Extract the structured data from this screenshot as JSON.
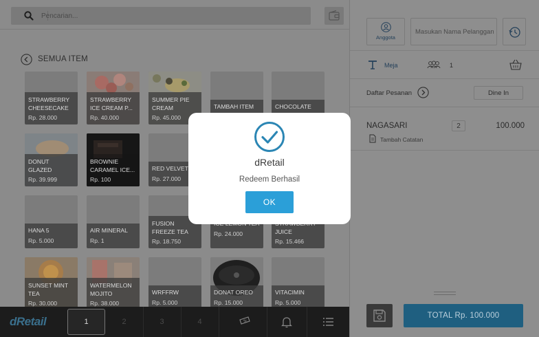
{
  "search": {
    "placeholder": "Pencarian..."
  },
  "category": {
    "title": "SEMUA ITEM"
  },
  "products": [
    {
      "name": "STRAWBERRY CHEESECAKE",
      "price": "Rp. 28.000"
    },
    {
      "name": "STRAWBERRY ICE CREAM P...",
      "price": "Rp. 40.000"
    },
    {
      "name": "SUMMER PIE CREAM",
      "price": "Rp. 45.000"
    },
    {
      "name": "TAMBAH ITEM TABLET",
      "price": ""
    },
    {
      "name": "CHOCOLATE COOKIES",
      "price": ""
    },
    {
      "name": "DONUT GLAZED",
      "price": "Rp. 39.999"
    },
    {
      "name": "BROWNIE CARAMEL ICE...",
      "price": "Rp. 100"
    },
    {
      "name": "RED VELVET",
      "price": "Rp. 27.000"
    },
    {
      "name": "",
      "price": ""
    },
    {
      "name": "",
      "price": ""
    },
    {
      "name": "HANA 5",
      "price": "Rp. 5.000"
    },
    {
      "name": "AIR MINERAL",
      "price": "Rp. 1"
    },
    {
      "name": "FUSION FREEZE TEA",
      "price": "Rp. 18.750"
    },
    {
      "name": "ICE LEMON TEA",
      "price": "Rp. 24.000"
    },
    {
      "name": "STRAWBERRY JUICE",
      "price": "Rp. 15.466"
    },
    {
      "name": "SUNSET MINT TEA",
      "price": "Rp. 30.000"
    },
    {
      "name": "WATERMELON MOJITO",
      "price": "Rp. 38.000"
    },
    {
      "name": "WRFFRW",
      "price": "Rp. 5.000"
    },
    {
      "name": "DONAT OREO",
      "price": "Rp. 15.000"
    },
    {
      "name": "VITACIMIN",
      "price": "Rp. 5.000"
    }
  ],
  "bottombar": {
    "logo": "dRetail",
    "pages": [
      "1",
      "2",
      "3",
      "4"
    ]
  },
  "sidebar": {
    "member_label": "Anggota",
    "customer_placeholder": "Masukan Nama Pelanggan",
    "table_label": "Meja",
    "people_count": "1",
    "order_list_label": "Daftar Pesanan",
    "order_type": "Dine In",
    "order_items": [
      {
        "name": "NAGASARI",
        "qty": "2",
        "price": "100.000",
        "note_label": "Tambah Catatan"
      }
    ],
    "total_label": "TOTAL Rp. 100.000"
  },
  "modal": {
    "title": "dRetail",
    "message": "Redeem Berhasil",
    "ok_label": "OK"
  },
  "colors": {
    "accent": "#2b9fd8",
    "total_button": "#1f5f80",
    "overlay_dim": "#8b8b8b",
    "bottombar": "#1c1c1c"
  }
}
